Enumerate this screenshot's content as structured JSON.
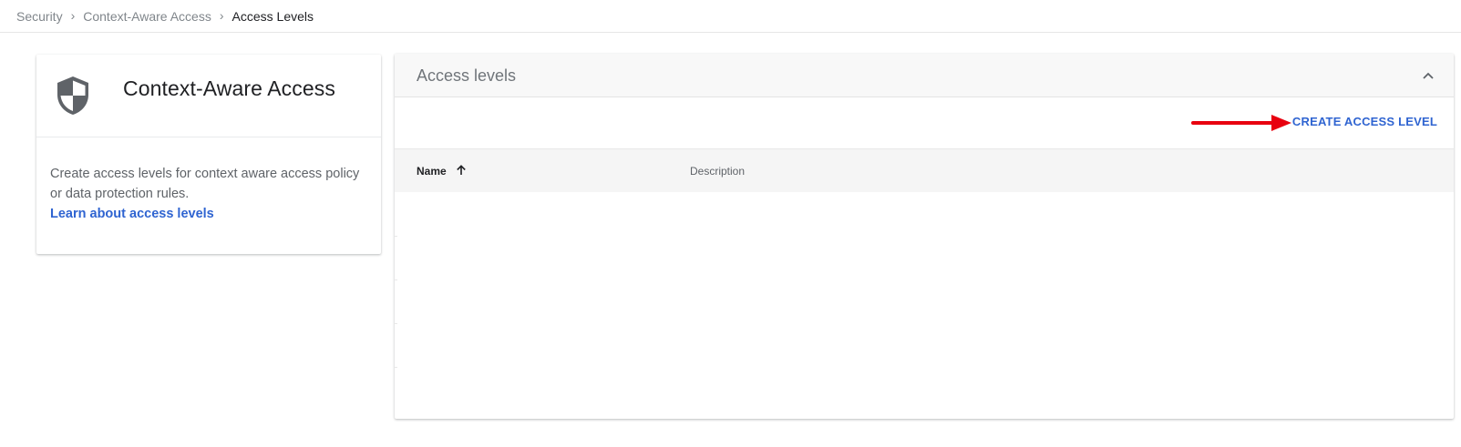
{
  "breadcrumb": {
    "items": [
      "Security",
      "Context-Aware Access",
      "Access Levels"
    ],
    "separator": ">"
  },
  "info_card": {
    "icon": "shield-icon",
    "title": "Context-Aware Access",
    "description": "Create access levels for context aware access policy or data protection rules.",
    "link_label": "Learn about access levels"
  },
  "panel": {
    "title": "Access levels",
    "collapse_icon": "chevron-up-icon",
    "create_label": "CREATE ACCESS LEVEL",
    "annotation_icon": "red-arrow-icon",
    "columns": [
      {
        "label": "Name",
        "sort": "ascending",
        "sort_icon": "arrow-up-icon"
      },
      {
        "label": "Description"
      }
    ],
    "rows": []
  },
  "colors": {
    "link": "#2f64d1",
    "annotation": "#e8000f",
    "header_bg": "#f8f8f8"
  }
}
